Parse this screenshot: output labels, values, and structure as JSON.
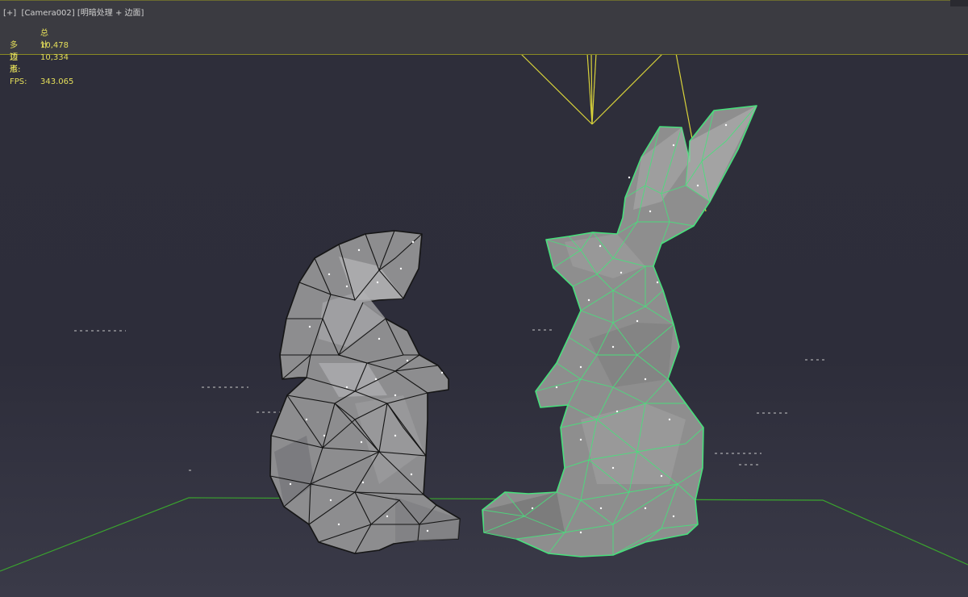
{
  "viewport": {
    "menu_label": "[+]",
    "camera_label": "[Camera002]",
    "shading_label": "[明暗处理 + 边面]"
  },
  "stats": {
    "header": "总计",
    "polys_label": "多边形:",
    "polys_value": "10,478",
    "verts_label": "顶点:",
    "verts_value": "10,334",
    "fps_label": "FPS:",
    "fps_value": "343.065"
  },
  "colors": {
    "background": "#2e2e3a",
    "overlay_text": "#e5df5a",
    "camera_lines": "#d8d23a",
    "selection_wire": "#48e07c",
    "wireframe": "#141414",
    "mesh": "#8c8c8c",
    "grid_line": "#3aa52e"
  }
}
